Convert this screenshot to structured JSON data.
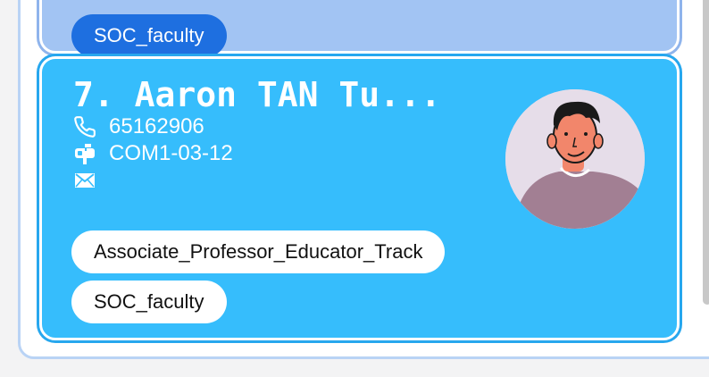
{
  "previous_card": {
    "tags": [
      "SOC_faculty"
    ]
  },
  "current_card": {
    "index_name": "7.  Aaron TAN Tu...",
    "phone": "65162906",
    "office": "COM1-03-12",
    "email": "",
    "tags": [
      "Associate_Professor_Educator_Track",
      "SOC_faculty"
    ]
  },
  "colors": {
    "card_selected": "#36bdfc",
    "card_previous": "#a2c4f3",
    "tag_blue": "#1e6fe0",
    "tag_white": "#ffffff"
  },
  "icons": {
    "phone": "phone-icon",
    "office": "mailbox-icon",
    "email": "envelope-icon",
    "avatar": "person-avatar"
  }
}
